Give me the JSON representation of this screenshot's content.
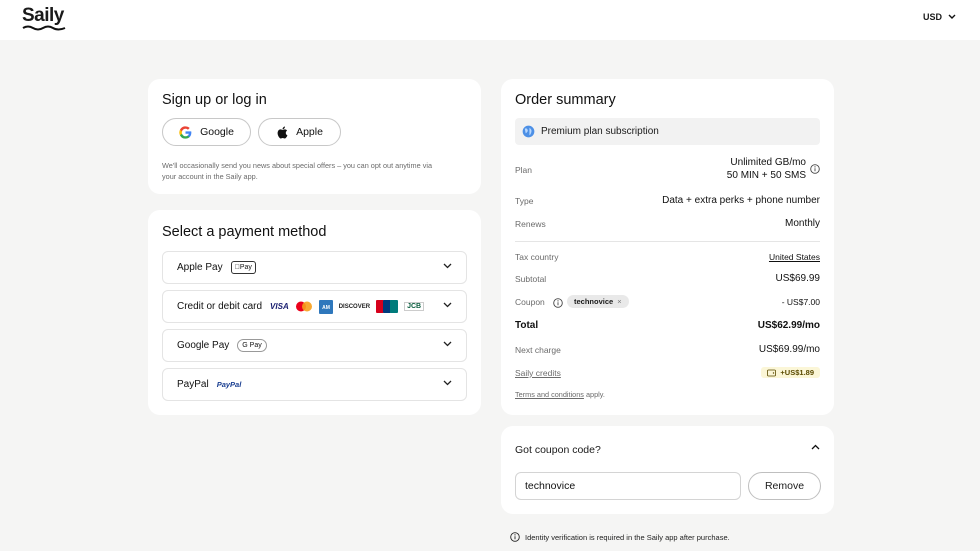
{
  "header": {
    "logo": "Saily",
    "currency": "USD"
  },
  "auth": {
    "title": "Sign up or log in",
    "google_label": "Google",
    "apple_label": "Apple",
    "note_line1": "We'll occasionally send you news about special offers – you can opt out anytime via",
    "note_line2": "your account in the Saily app."
  },
  "payment": {
    "title": "Select a payment method",
    "methods": [
      {
        "label": "Apple Pay",
        "badge": "Pay"
      },
      {
        "label": "Credit or debit card"
      },
      {
        "label": "Google Pay",
        "badge": "G Pay"
      },
      {
        "label": "PayPal",
        "badge": "PayPal"
      }
    ],
    "card_logos": [
      "VISA",
      "DISCOVER",
      "JCB"
    ]
  },
  "order": {
    "title": "Order summary",
    "plan_name": "Premium plan subscription",
    "rows": {
      "plan_label": "Plan",
      "plan_value_1": "Unlimited GB/mo",
      "plan_value_2": "50 MIN + 50 SMS",
      "type_label": "Type",
      "type_value": "Data + extra perks + phone number",
      "renews_label": "Renews",
      "renews_value": "Monthly",
      "tax_label": "Tax country",
      "tax_value": "United States",
      "subtotal_label": "Subtotal",
      "subtotal_value": "US$69.99",
      "coupon_label": "Coupon",
      "coupon_code": "technovice",
      "coupon_value": "- US$7.00",
      "total_label": "Total",
      "total_value": "US$62.99/mo",
      "next_label": "Next charge",
      "next_value": "US$69.99/mo",
      "credits_label": "Saily credits",
      "credits_value": "+US$1.89",
      "terms_link": "Terms and conditions",
      "terms_suffix": " apply."
    }
  },
  "coupon": {
    "title": "Got coupon code?",
    "input_value": "technovice",
    "remove_label": "Remove"
  },
  "footer_note": "Identity verification is required in the Saily app after purchase."
}
